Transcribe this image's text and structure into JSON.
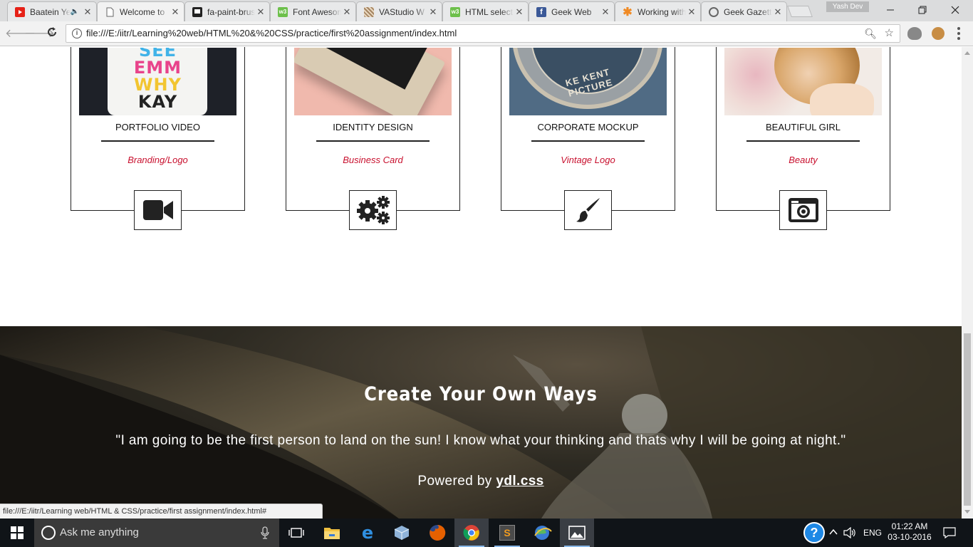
{
  "browser": {
    "tabs": [
      {
        "title": "Baatein Ye",
        "favicon": "youtube-icon",
        "color": "#e62117",
        "active": false
      },
      {
        "title": "Welcome to",
        "favicon": "document-icon",
        "color": "#ffffff",
        "active": true
      },
      {
        "title": "fa-paint-brush",
        "favicon": "flag-icon",
        "color": "#222222",
        "active": false
      },
      {
        "title": "Font Awesome",
        "favicon": "w3schools-icon",
        "color": "#6dc04b",
        "active": false
      },
      {
        "title": "VAStudio W",
        "favicon": "pattern-icon",
        "color": "#a58562",
        "active": false
      },
      {
        "title": "HTML select",
        "favicon": "w3schools-icon",
        "color": "#6dc04b",
        "active": false
      },
      {
        "title": "Geek Web",
        "favicon": "facebook-icon",
        "color": "#3b5998",
        "active": false
      },
      {
        "title": "Working with",
        "favicon": "asterisk-icon",
        "color": "#f08a24",
        "active": false
      },
      {
        "title": "Geek Gazette",
        "favicon": "spiral-icon",
        "color": "#666666",
        "active": false
      }
    ],
    "user": "Yash Dev",
    "address": "file:///E:/iitr/Learning%20web/HTML%20&%20CSS/practice/first%20assignment/index.html",
    "status_url": "file:///E:/iitr/Learning web/HTML & CSS/practice/first assignment/index.html#"
  },
  "portfolio": [
    {
      "title": "PORTFOLIO VIDEO",
      "category": "Branding/Logo",
      "icon": "video-camera-icon",
      "thumb_lines": [
        "SEE",
        "EMM",
        "WHY",
        "KAY"
      ]
    },
    {
      "title": "IDENTITY DESIGN",
      "category": "Business Card",
      "icon": "gears-icon"
    },
    {
      "title": "CORPORATE MOCKUP",
      "category": "Vintage Logo",
      "icon": "paint-brush-icon",
      "thumb_text": "KE KENT PICTURE"
    },
    {
      "title": "BEAUTIFUL GIRL",
      "category": "Beauty",
      "icon": "camera-icon"
    }
  ],
  "footer": {
    "title": "Create Your Own Ways",
    "quote": "\"I am going to be the first person to land on the sun! I know what your thinking and thats why I will be going at night.\"",
    "powered_prefix": "Powered by ",
    "powered_link": "ydl.css"
  },
  "taskbar": {
    "search_placeholder": "Ask me anything",
    "language": "ENG",
    "time": "01:22 AM",
    "date": "03-10-2016"
  },
  "colors": {
    "accent_red": "#c8102e",
    "taskbar_bg": "#101418"
  }
}
